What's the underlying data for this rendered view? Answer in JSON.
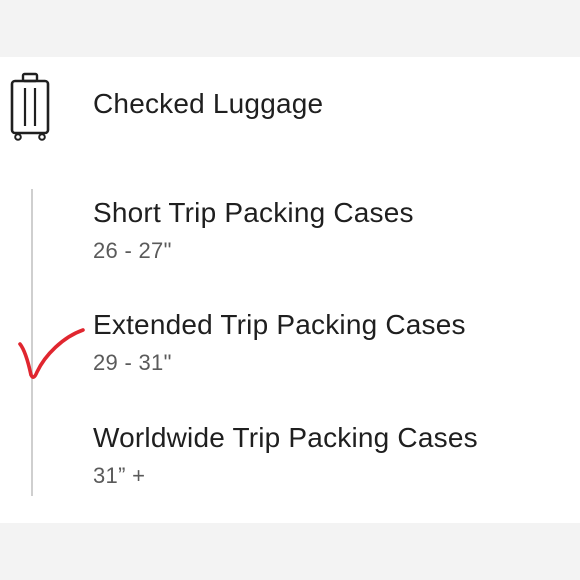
{
  "header": {
    "title": "Checked Luggage",
    "icon": "luggage-icon"
  },
  "options": [
    {
      "title": "Short Trip Packing Cases",
      "size": "26 - 27\"",
      "selected": false
    },
    {
      "title": "Extended Trip Packing Cases",
      "size": "29 - 31\"",
      "selected": true
    },
    {
      "title": "Worldwide Trip Packing Cases",
      "size": "31” +",
      "selected": false
    }
  ],
  "colors": {
    "text": "#1f1f1f",
    "subtext": "#5a5a5a",
    "checkmark": "#e0262f",
    "timeline": "#cfcfcf"
  }
}
